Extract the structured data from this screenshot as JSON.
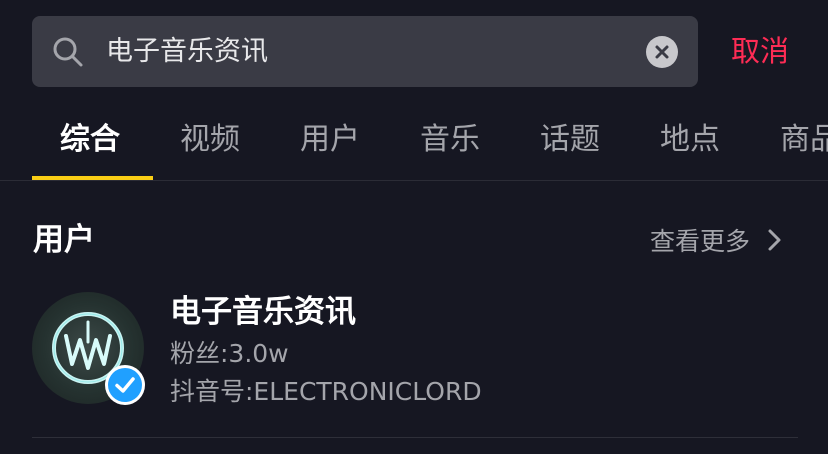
{
  "search": {
    "query": "电子音乐资讯",
    "search_icon": "search-icon",
    "clear_icon": "clear-icon"
  },
  "cancel_label": "取消",
  "tabs": [
    {
      "label": "综合",
      "active": true
    },
    {
      "label": "视频",
      "active": false
    },
    {
      "label": "用户",
      "active": false
    },
    {
      "label": "音乐",
      "active": false
    },
    {
      "label": "话题",
      "active": false
    },
    {
      "label": "地点",
      "active": false
    },
    {
      "label": "商品",
      "active": false
    }
  ],
  "section": {
    "title": "用户",
    "see_more": "查看更多",
    "see_more_icon": "chevron-right-icon"
  },
  "user": {
    "name": "电子音乐资讯",
    "fans": "粉丝:3.0w",
    "douyin_id": "抖音号:ELECTRONICLORD",
    "verified": true
  },
  "colors": {
    "background": "#161722",
    "search_bg": "#3a3b45",
    "accent_red": "#fe2c55",
    "tab_indicator": "#face15",
    "secondary_text": "#a4a5ab",
    "verified_blue": "#20a0ff"
  }
}
